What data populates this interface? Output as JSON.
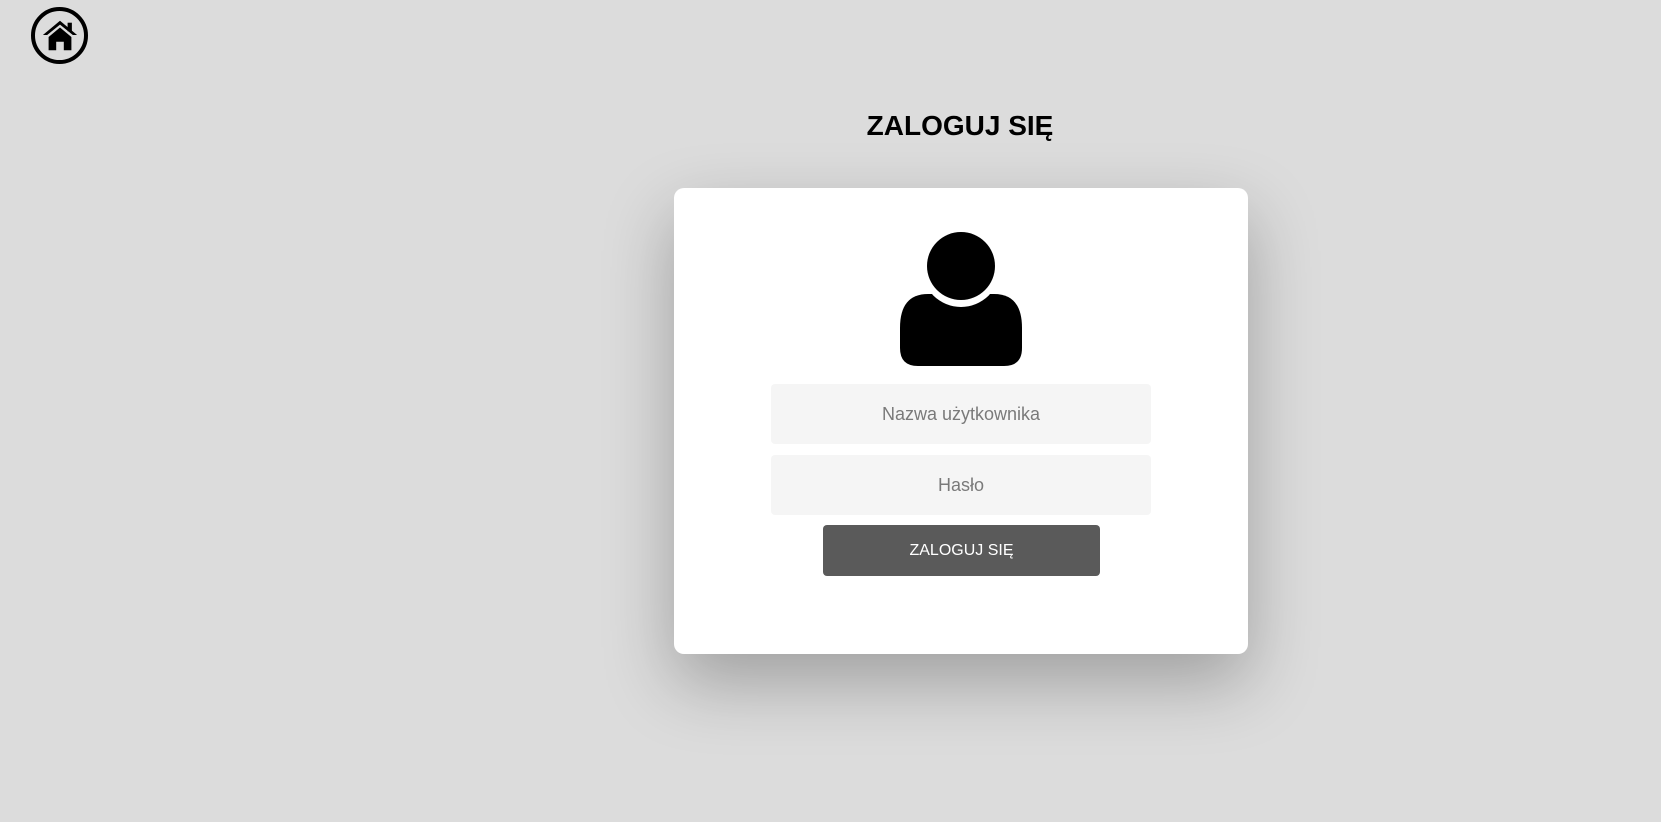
{
  "nav": {
    "home_icon": "home-icon"
  },
  "page": {
    "title": "ZALOGUJ SIĘ"
  },
  "login_form": {
    "avatar_icon": "user-avatar-icon",
    "username": {
      "value": "",
      "placeholder": "Nazwa użytkownika"
    },
    "password": {
      "value": "",
      "placeholder": "Hasło"
    },
    "submit_label": "ZALOGUJ SIĘ"
  },
  "colors": {
    "background": "#dcdcdc",
    "card": "#ffffff",
    "input_background": "#f5f5f5",
    "button": "#5a5a5a",
    "button_text": "#ffffff"
  }
}
